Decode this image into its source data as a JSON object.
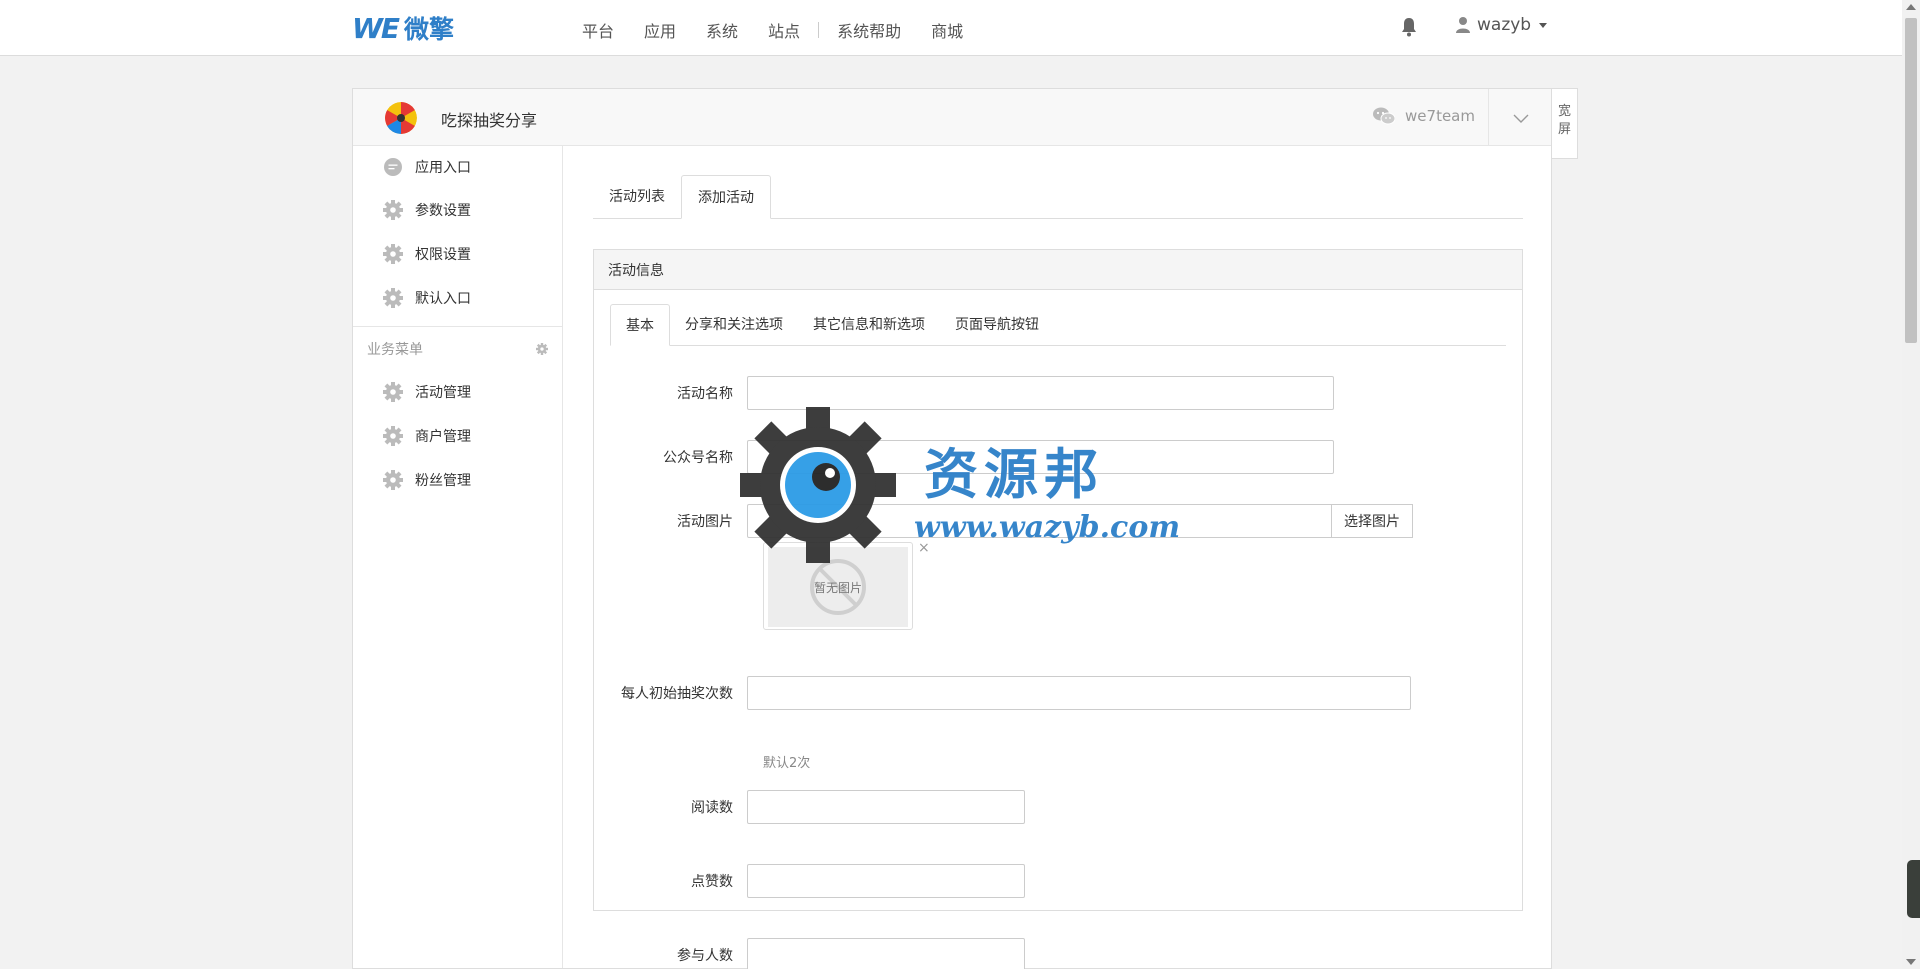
{
  "topbar": {
    "logo_mark": "WE",
    "logo_text": "微擎",
    "nav": [
      "平台",
      "应用",
      "系统",
      "站点",
      "系统帮助",
      "商城"
    ],
    "username": "wazyb"
  },
  "module": {
    "name": "吃探抽奖分享",
    "wechat_account": "we7team",
    "wide_label": "宽屏"
  },
  "sidebar": {
    "items": [
      "应用入口",
      "参数设置",
      "权限设置",
      "默认入口"
    ],
    "group_label": "业务菜单",
    "business_items": [
      "活动管理",
      "商户管理",
      "粉丝管理"
    ]
  },
  "tabs": [
    "活动列表",
    "添加活动"
  ],
  "active_tab": "添加活动",
  "form": {
    "box_title": "活动信息",
    "subtabs": [
      "基本",
      "分享和关注选项",
      "其它信息和新选项",
      "页面导航按钮"
    ],
    "fields": {
      "name_label": "活动名称",
      "account_label": "公众号名称",
      "image_label": "活动图片",
      "choose_image": "选择图片",
      "no_image": "暂无图片",
      "draws_label": "每人初始抽奖次数",
      "draws_help": "默认2次",
      "reads_label": "阅读数",
      "likes_label": "点赞数",
      "participants_label": "参与人数"
    }
  },
  "watermark": {
    "title": "资源邦",
    "url": "www.wazyb.com"
  },
  "colors": {
    "brand": "#2f7fc8",
    "border": "#dddddd",
    "background": "#f2f2f2"
  }
}
